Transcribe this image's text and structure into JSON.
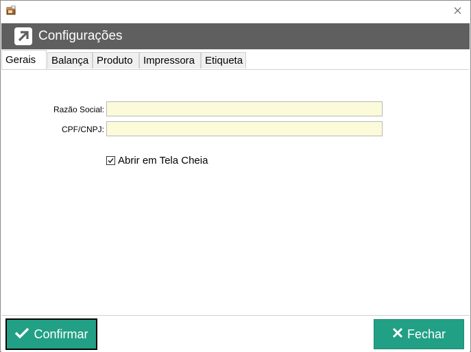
{
  "window": {
    "icons": {
      "app": "app-package-icon",
      "close": "close-icon"
    }
  },
  "header": {
    "title": "Configurações",
    "logo_icon": "arrow-up-left-logo-icon",
    "background_color": "#5f5f5f"
  },
  "tabs": [
    {
      "label": "Gerais",
      "active": true
    },
    {
      "label": "Balança",
      "active": false
    },
    {
      "label": "Produto",
      "active": false
    },
    {
      "label": "Impressora",
      "active": false
    },
    {
      "label": "Etiqueta",
      "active": false
    }
  ],
  "form": {
    "razao_social": {
      "label": "Razão Social:",
      "value": ""
    },
    "cpf_cnpj": {
      "label": "CPF/CNPJ:",
      "value": ""
    },
    "fullscreen": {
      "label": "Abrir em Tela Cheia",
      "checked": true
    },
    "input_background": "#fbfbd9"
  },
  "footer": {
    "confirm": {
      "label": "Confirmar",
      "icon": "check-icon"
    },
    "close": {
      "label": "Fechar",
      "icon": "x-icon"
    },
    "button_color": "#22a085"
  }
}
